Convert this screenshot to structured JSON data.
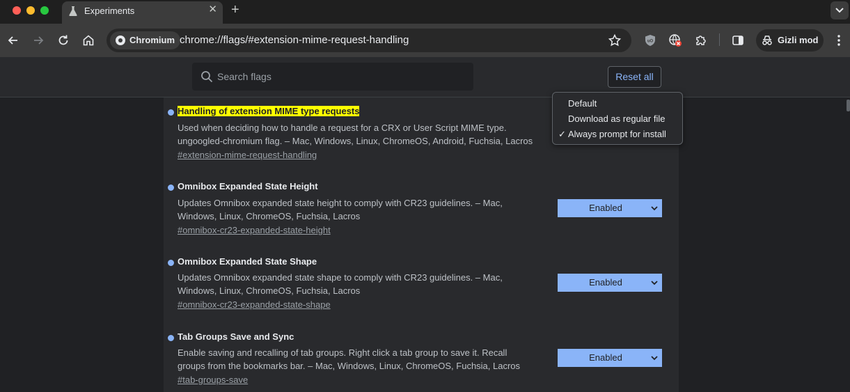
{
  "tab": {
    "title": "Experiments",
    "close_glyph": "✕",
    "new_tab_glyph": "+"
  },
  "omnibox": {
    "chip_label": "Chromium",
    "url": "chrome://flags/#extension-mime-request-handling"
  },
  "incognito": {
    "label": "Gizli mod"
  },
  "header": {
    "search_placeholder": "Search flags",
    "reset_label": "Reset all"
  },
  "experiments": [
    {
      "title": "Handling of extension MIME type requests",
      "desc_lines": [
        "Used when deciding how to handle a request for a CRX or User Script MIME type.",
        "ungoogled-chromium flag. – Mac, Windows, Linux, ChromeOS, Android, Fuchsia, Lacros"
      ],
      "link": "#extension-mime-request-handling",
      "selected": "Always prompt for install",
      "highlighted": true
    },
    {
      "title": "Omnibox Expanded State Height",
      "desc_lines": [
        "Updates Omnibox expanded state height to comply with CR23 guidelines. – Mac,",
        "Windows, Linux, ChromeOS, Fuchsia, Lacros"
      ],
      "link": "#omnibox-cr23-expanded-state-height",
      "selected": "Enabled"
    },
    {
      "title": "Omnibox Expanded State Shape",
      "desc_lines": [
        "Updates Omnibox expanded state shape to comply with CR23 guidelines. – Mac,",
        "Windows, Linux, ChromeOS, Fuchsia, Lacros"
      ],
      "link": "#omnibox-cr23-expanded-state-shape",
      "selected": "Enabled"
    },
    {
      "title": "Tab Groups Save and Sync",
      "desc_lines": [
        "Enable saving and recalling of tab groups. Right click a tab group to save it. Recall",
        "groups from the bookmarks bar. – Mac, Windows, Linux, ChromeOS, Fuchsia, Lacros"
      ],
      "link": "#tab-groups-save",
      "selected": "Enabled"
    }
  ],
  "dropdown": {
    "options": [
      "Default",
      "Download as regular file",
      "Always prompt for install"
    ],
    "checked_glyph": "✓"
  },
  "colors": {
    "accent": "#8ab4f8",
    "highlight": "#ffff00",
    "page_bg": "#202124",
    "card_bg": "#292a2d"
  },
  "icons": {
    "tab": "flask-icon",
    "back": "back-arrow-icon",
    "forward": "forward-arrow-icon",
    "reload": "reload-icon",
    "home": "home-icon",
    "bookmark": "star-icon",
    "ext1": "ublock-shield-icon",
    "ext2": "blocked-globe-icon",
    "extensions": "puzzle-icon",
    "side_panel": "side-panel-icon",
    "incognito": "incognito-icon",
    "menu": "kebab-menu-icon",
    "search": "search-icon",
    "chevron": "chevron-down-icon"
  }
}
